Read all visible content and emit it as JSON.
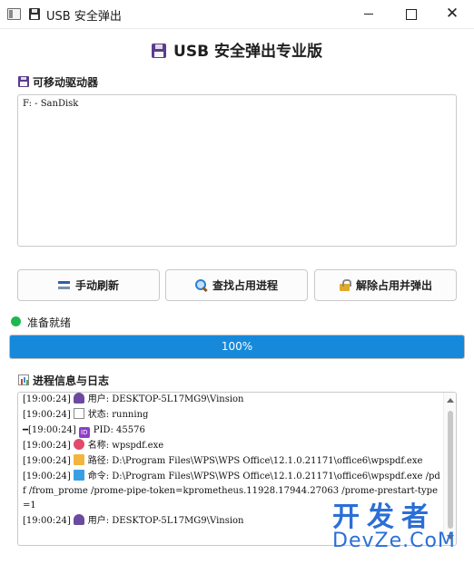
{
  "window": {
    "title": "USB 安全弹出"
  },
  "app": {
    "heading": "USB 安全弹出专业版"
  },
  "drives": {
    "label": "可移动驱动器",
    "items": [
      "F: - SanDisk"
    ]
  },
  "buttons": {
    "refresh": "手动刷新",
    "find": "查找占用进程",
    "eject": "解除占用并弹出"
  },
  "status": {
    "text": "准备就绪",
    "color": "#1fb84e"
  },
  "progress": {
    "value": 100,
    "label": "100%",
    "color": "#1789da"
  },
  "log": {
    "label": "进程信息与日志",
    "lines": [
      {
        "prefix": "[19:00:24]",
        "icon": "user-icon",
        "text": "用户: DESKTOP-5L17MG9\\Vinsion"
      },
      {
        "prefix": "[19:00:24]",
        "icon": "bar-chart-icon",
        "text": "状态: running"
      },
      {
        "prefix": "━[19:00:24]",
        "icon": "id-icon",
        "text": "PID: 45576"
      },
      {
        "prefix": "[19:00:24]",
        "icon": "lips-icon",
        "text": "名称: wpspdf.exe"
      },
      {
        "prefix": "[19:00:24]",
        "icon": "folder-icon",
        "text": "路径: D:\\Program Files\\WPS\\WPS Office\\12.1.0.21171\\office6\\wpspdf.exe"
      },
      {
        "prefix": "[19:00:24]",
        "icon": "computer-icon",
        "text": "命令: D:\\Program Files\\WPS\\WPS Office\\12.1.0.21171\\office6\\wpspdf.exe /pdf /from_prome /prome-pipe-token=kprometheus.11928.17944.27063 /prome-prestart-type=1"
      },
      {
        "prefix": "[19:00:24]",
        "icon": "user-icon",
        "text": "用户: DESKTOP-5L17MG9\\Vinsion"
      }
    ]
  },
  "watermark": {
    "top": "开发者",
    "bottom": "DevZe.CoM"
  }
}
